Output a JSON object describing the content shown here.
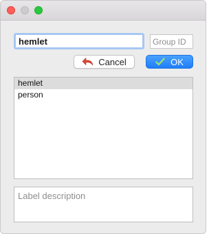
{
  "window": {
    "controls": [
      "close",
      "minimize",
      "zoom"
    ],
    "colors": {
      "close": "#fe5f57",
      "minimize": "#cdcbcd",
      "zoom": "#2ac840"
    }
  },
  "form": {
    "label_value": "hemlet",
    "group_placeholder": "Group ID",
    "cancel_label": "Cancel",
    "ok_label": "OK",
    "cancel_icon": "undo-arrow-icon",
    "ok_icon": "checkmark-icon"
  },
  "labels_list": {
    "items": [
      "hemlet",
      "person"
    ],
    "selected": "hemlet"
  },
  "description": {
    "placeholder": "Label description"
  },
  "colors": {
    "accent": "#1f7ef7",
    "selection": "#dcdcdc",
    "focus_ring": "#a7c7f2"
  }
}
